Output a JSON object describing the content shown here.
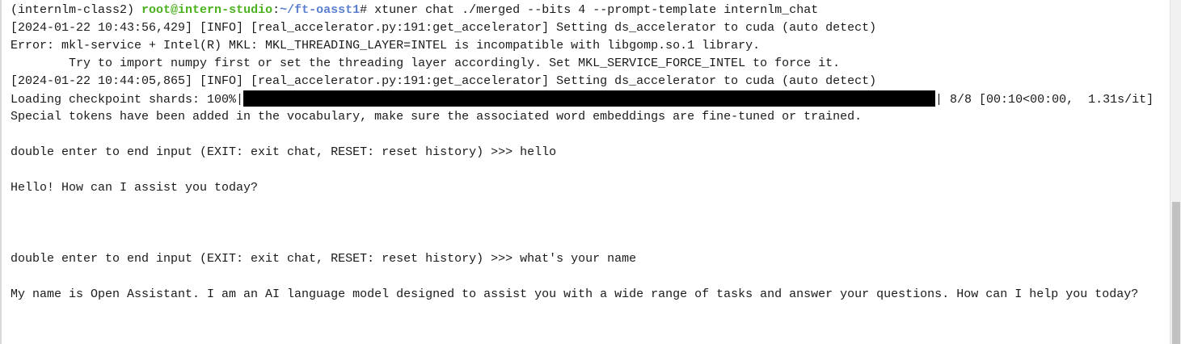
{
  "terminal": {
    "prompt": {
      "env": "(internlm-class2)",
      "user_host": "root@intern-studio",
      "path": "~/ft-oasst1",
      "symbol": "#",
      "command": "xtuner chat ./merged --bits 4 --prompt-template internlm_chat"
    },
    "log1": "[2024-01-22 10:43:56,429] [INFO] [real_accelerator.py:191:get_accelerator] Setting ds_accelerator to cuda (auto detect)",
    "error1": "Error: mkl-service + Intel(R) MKL: MKL_THREADING_LAYER=INTEL is incompatible with libgomp.so.1 library.",
    "error2": "        Try to import numpy first or set the threading layer accordingly. Set MKL_SERVICE_FORCE_INTEL to force it.",
    "log2": "[2024-01-22 10:44:05,865] [INFO] [real_accelerator.py:191:get_accelerator] Setting ds_accelerator to cuda (auto detect)",
    "progress": {
      "prefix": "Loading checkpoint shards: 100%|",
      "suffix": "| 8/8 [00:10<00:00,  1.31s/it]",
      "percent": 100
    },
    "special_tokens": "Special tokens have been added in the vocabulary, make sure the associated word embeddings are fine-tuned or trained.",
    "chat1_prompt": "double enter to end input (EXIT: exit chat, RESET: reset history) >>> hello",
    "chat1_reply": "Hello! How can I assist you today?",
    "chat2_prompt": "double enter to end input (EXIT: exit chat, RESET: reset history) >>> what's your name",
    "chat2_reply": "My name is Open Assistant. I am an AI language model designed to assist you with a wide range of tasks and answer your questions. How can I help you today?"
  },
  "colors": {
    "user_host": "#4cb11e",
    "path": "#5b7fce",
    "text": "#1a1a1a",
    "background": "#ffffff"
  }
}
